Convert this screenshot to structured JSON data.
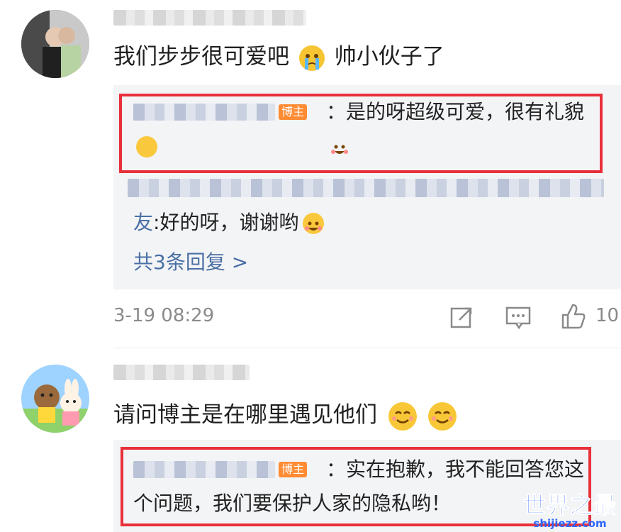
{
  "comment1": {
    "text": "我们步步很可爱吧",
    "text_after": "帅小伙子了",
    "reply_badge": "博主",
    "reply_text": "：是的呀超级可爱，很有礼貌",
    "reply2_prefix": "友",
    "reply2_text": ":好的呀，谢谢哟",
    "more_replies": "共3条回复 >",
    "time": "3-19 08:29",
    "like_count": "10"
  },
  "comment2": {
    "text": "请问博主是在哪里遇见他们",
    "reply_badge": "博主",
    "reply_text": "：实在抱歉，我不能回答您这个问题，我们要保护人家的隐私哟！"
  },
  "watermark": {
    "title": "世界之最",
    "url": "shijiezz.com"
  },
  "icons": [
    "share-icon",
    "comment-icon",
    "like-icon",
    "crying-emoji-icon",
    "smile-emoji-icon",
    "grin-emoji-icon"
  ],
  "colors": {
    "accent": "#e8303b",
    "badge": "#ff8b33",
    "link": "#4a6fa5",
    "watermark": "#2b66ff"
  }
}
